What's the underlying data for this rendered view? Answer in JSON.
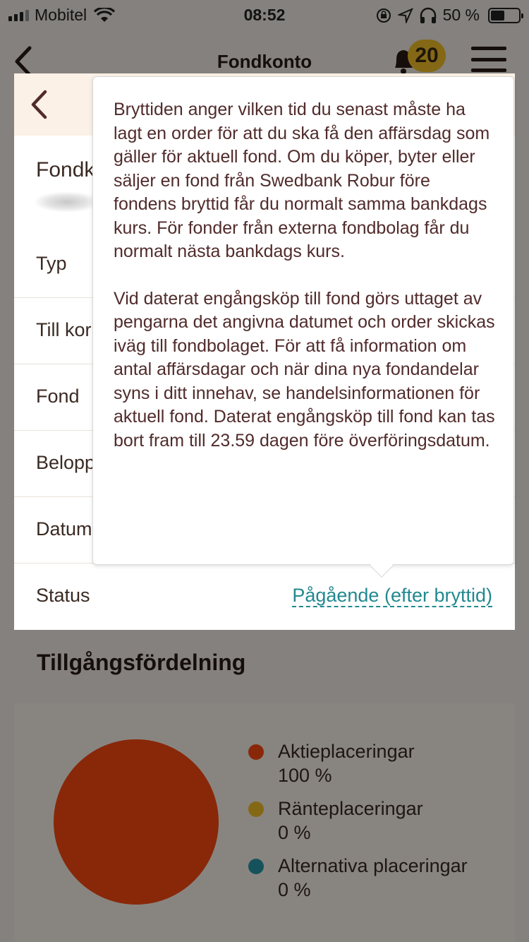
{
  "status_bar": {
    "carrier": "Mobitel",
    "time": "08:52",
    "battery_text": "50 %"
  },
  "nav": {
    "title": "Fondkonto",
    "notification_count": "20"
  },
  "card": {
    "title": "Fondk",
    "rows": [
      {
        "label": "Typ"
      },
      {
        "label": "Till kor"
      },
      {
        "label": "Fond"
      },
      {
        "label": "Belopp"
      },
      {
        "label": "Datum"
      },
      {
        "label": "Status"
      }
    ],
    "status_value": "Pågående (efter bryttid)"
  },
  "tooltip": {
    "paragraph1": "Bryttiden anger vilken tid du senast måste ha lagt en order för att du ska få den affärsdag som gäller för aktuell fond. Om du köper, byter eller säljer en fond från Swedbank Robur före fondens bryttid får du normalt samma bankdags kurs. För fonder från externa fondbolag får du normalt nästa bankdags kurs.",
    "paragraph2": "Vid daterat engångsköp till fond görs uttaget av pengarna det angivna datumet och order skickas iväg till fondbolaget. För att få information om antal affärsdagar och när dina nya fondandelar syns i ditt innehav, se handelsinformationen för aktuell fond. Daterat engångsköp till fond kan tas bort fram till 23.59 dagen före överföringsdatum."
  },
  "allocation": {
    "title": "Tillgångsfördelning",
    "items": [
      {
        "name": "Aktieplaceringar",
        "value": "100 %",
        "color": "#fb4a10"
      },
      {
        "name": "Ränteplaceringar",
        "value": "0 %",
        "color": "#f6c02a"
      },
      {
        "name": "Alternativa placeringar",
        "value": "0 %",
        "color": "#2a98a8"
      }
    ]
  },
  "colors": {
    "accent": "#21898f",
    "brand_text": "#512b2b",
    "badge": "#f6c02a"
  }
}
